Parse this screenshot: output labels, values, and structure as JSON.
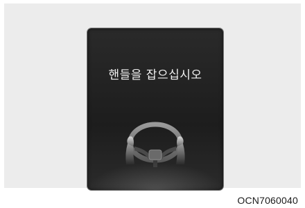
{
  "display": {
    "message": "핸들을 잡으십시오",
    "icon": "steering-wheel-hands-icon",
    "background_color": "#222222",
    "text_color": "#f2f2f2"
  },
  "caption": {
    "code": "OCN7060040"
  }
}
